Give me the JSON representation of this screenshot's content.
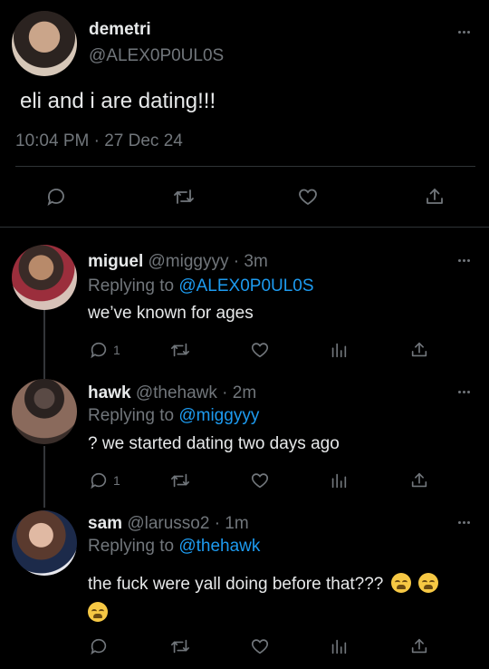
{
  "main_tweet": {
    "name": "demetri",
    "handle": "@ALEX0P0UL0S",
    "text": "eli and i are dating!!!",
    "timestamp": "10:04 PM · 27 Dec 24"
  },
  "replies": [
    {
      "name": "miguel",
      "handle": "@miggyyy",
      "time": "· 3m",
      "replying_prefix": "Replying to",
      "replying_to": "@ALEX0P0UL0S",
      "text": "we’ve known for ages",
      "reply_count": "1"
    },
    {
      "name": "hawk",
      "handle": "@thehawk",
      "time": "· 2m",
      "replying_prefix": "Replying to",
      "replying_to": "@miggyyy",
      "text": "? we started dating two days ago",
      "reply_count": "1"
    },
    {
      "name": "sam",
      "handle": "@larusso2",
      "time": "· 1m",
      "replying_prefix": "Replying to",
      "replying_to": "@thehawk",
      "text": "the fuck were yall doing before that???",
      "reply_count": ""
    }
  ],
  "icons": {
    "reply": "reply-icon",
    "retweet": "retweet-icon",
    "like": "heart-icon",
    "views": "views-icon",
    "share": "share-icon",
    "more": "more-icon",
    "emoji": "loudly-crying-face-emoji"
  },
  "colors": {
    "background": "#000000",
    "text": "#e7e9ea",
    "muted": "#71767b",
    "link": "#1d9bf0"
  }
}
